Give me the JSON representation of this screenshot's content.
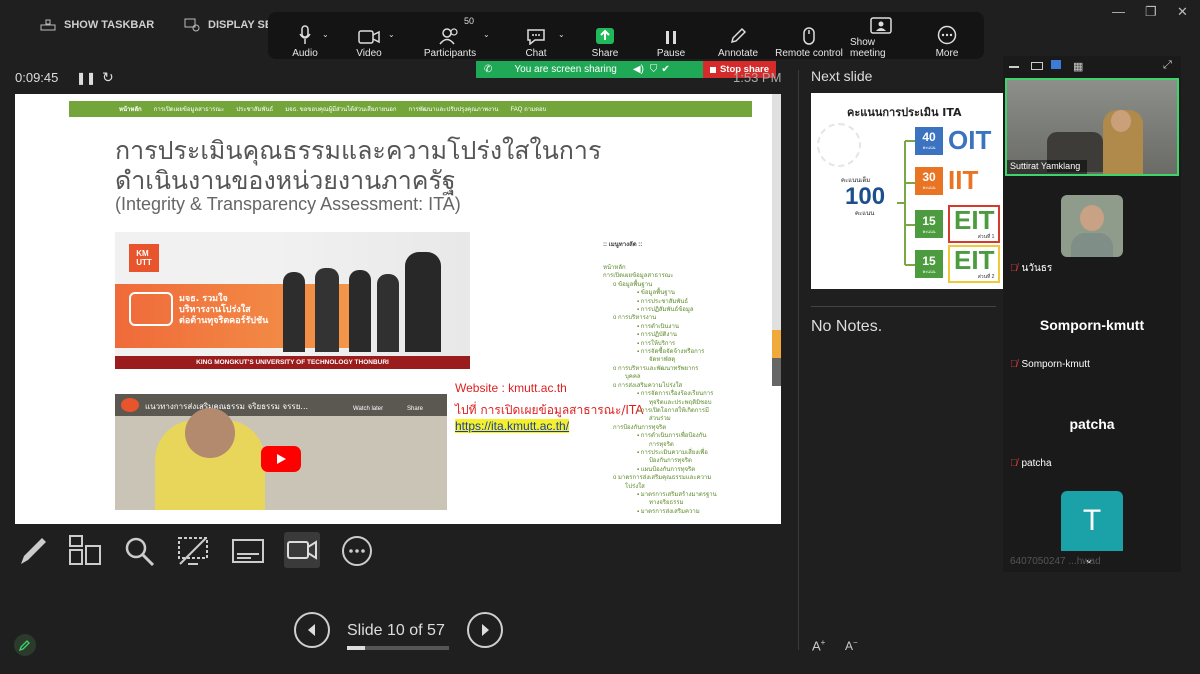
{
  "taskbar": {
    "show_taskbar": "SHOW TASKBAR",
    "display_settings": "DISPLAY SET"
  },
  "zoom_toolbar": {
    "audio": "Audio",
    "video": "Video",
    "participants": "Participants",
    "participants_count": "50",
    "chat": "Chat",
    "share": "Share",
    "pause": "Pause",
    "annotate": "Annotate",
    "remote_control": "Remote control",
    "show_meeting": "Show meeting",
    "more": "More"
  },
  "sharing": {
    "banner": "You are screen sharing",
    "stop_share": "Stop share"
  },
  "presenter": {
    "timer": "0:09:45",
    "clock": "1:53 PM",
    "next_slide_label": "Next slide",
    "notes": "No Notes.",
    "slide_counter": "Slide 10 of 57"
  },
  "slide": {
    "nav_items": [
      "หน้าหลัก",
      "การเปิดเผยข้อมูลสาธารณะ",
      "ประชาสัมพันธ์",
      "มจธ. ขอขอบคุณผู้มีส่วนได้ส่วนเสียภายนอก",
      "การพัฒนาและปรับปรุงคุณภาพงาน",
      "FAQ ถามตอบ"
    ],
    "title_line1": "การประเมินคุณธรรมและความโปร่งใสในการ",
    "title_line2": "ดำเนินงานของหน่วยงานภาครัฐ",
    "subtitle": "(Integrity & Transparency Assessment: ITA)",
    "banner_text1": "มจธ. รวมใจ",
    "banner_text2": "บริหารงานโปร่งใส",
    "banner_text3": "ต่อต้านทุจริตคอร์รัปชัน",
    "banner_footer": "KING MONGKUT'S UNIVERSITY OF TECHNOLOGY THONBURI",
    "video_title": "แนวทางการส่งเสริมคุณธรรม จริยธรรม จรรย...",
    "watch_later": "Watch later",
    "share": "Share",
    "website_label": "Website : kmutt.ac.th",
    "goto_label": "ไปที่ การเปิดเผยข้อมูลสาธารณะ/ITA",
    "link": "https://ita.kmutt.ac.th/",
    "menu_header": ":: เมนูทางลัด ::",
    "menu_items": [
      "หน้าหลัก",
      "การเปิดเผยข้อมูลสาธารณะ",
      "o ข้อมูลพื้นฐาน",
      "▪ ข้อมูลพื้นฐาน",
      "▪ การประชาสัมพันธ์",
      "▪ การปฏิสัมพันธ์ข้อมูล",
      "o การบริหารงาน",
      "▪ การดำเนินงาน",
      "▪ การปฏิบัติงาน",
      "▪ การให้บริการ",
      "▪ การจัดซื้อจัดจ้างหรือการ",
      "จัดหาพัสดุ",
      "o การบริหารและพัฒนาทรัพยากร",
      "บุคคล",
      "o การส่งเสริมความโปร่งใส",
      "▪ การจัดการเรื่องร้องเรียนการ",
      "ทุจริตและประพฤติมิชอบ",
      "▪ การเปิดโอกาสให้เกิดการมี",
      "ส่วนร่วม",
      "การป้องกันการทุจริต",
      "▪ การดำเนินการเพื่อป้องกัน",
      "การทุจริต",
      "▪ การประเมินความเสี่ยงเพื่อ",
      "ป้องกันการทุจริต",
      "▪ แผนป้องกันการทุจริต",
      "o มาตรการส่งเสริมคุณธรรมและความ",
      "โปร่งใส",
      "▪ มาตรการเสริมสร้างมาตรฐาน",
      "ทางจริยธรรม",
      "▪ มาตรการส่งเสริมความ"
    ]
  },
  "next_slide": {
    "title": "คะแนนการประเมิน ITA",
    "total_label": "คะแนนเต็ม",
    "total_value": "100",
    "total_unit": "คะแนน",
    "rows": [
      {
        "score": "40",
        "unit": "คะแนน",
        "label": "OIT",
        "note": ""
      },
      {
        "score": "30",
        "unit": "คะแนน",
        "label": "IIT",
        "note": ""
      },
      {
        "score": "15",
        "unit": "คะแนน",
        "label": "EIT",
        "note": "ส่วนที่ 1"
      },
      {
        "score": "15",
        "unit": "คะแนน",
        "label": "EIT",
        "note": "ส่วนที่ 2"
      }
    ]
  },
  "participants_panel": {
    "video_name": "Suttirat Yamklang",
    "p2_name": "นวันธร",
    "p3_big": "Somporn-kmutt",
    "p3_tag": "Somporn-kmutt",
    "p4_big": "patcha",
    "p4_tag": "patcha",
    "p5_initial": "T",
    "p5_tag": "6407050247 ...hwad"
  },
  "colors": {
    "share_green": "#1fa855",
    "stop_red": "#d52b2b",
    "speaker_border": "#3fd46a",
    "nav_green": "#73a53a"
  }
}
